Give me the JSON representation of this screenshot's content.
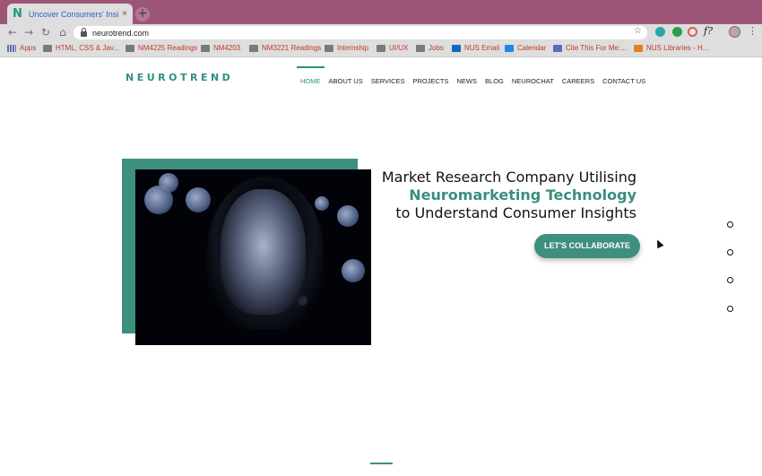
{
  "browser": {
    "tab_title": "Uncover Consumers' Insights",
    "tab_favicon": "N",
    "tab_close": "×",
    "new_tab": "+",
    "url": "neurotrend.com",
    "back": "←",
    "forward": "→",
    "reload": "↻",
    "home": "⌂",
    "star": "☆",
    "ext_f": "f?",
    "menu": "⋮"
  },
  "bookmarks": [
    {
      "label": "Apps",
      "icon": "apps-icon"
    },
    {
      "label": "HTML, CSS & Jav...",
      "icon": "folder-icon"
    },
    {
      "label": "NM4225 Readings",
      "icon": "folder-icon"
    },
    {
      "label": "NM4203",
      "icon": "folder-icon"
    },
    {
      "label": "NM3221 Readings",
      "icon": "folder-icon"
    },
    {
      "label": "Internship",
      "icon": "folder-icon"
    },
    {
      "label": "UI/UX",
      "icon": "folder-icon"
    },
    {
      "label": "Jobs",
      "icon": "folder-icon"
    },
    {
      "label": "NUS Email",
      "icon": "outlook-icon"
    },
    {
      "label": "Calendar",
      "icon": "calendar-icon"
    },
    {
      "label": "Cite This For Me:...",
      "icon": "doc-icon"
    },
    {
      "label": "NUS Libraries - H...",
      "icon": "library-icon"
    }
  ],
  "site": {
    "logo": "NEUROTREND",
    "nav": [
      "HOME",
      "ABOUT US",
      "SERVICES",
      "PROJECTS",
      "NEWS",
      "BLOG",
      "NEUROCHAT",
      "CAREERS",
      "CONTACT US"
    ],
    "headline": {
      "line1": "Market Research Company Utilising",
      "line2": "Neuromarketing Technology",
      "line3": "to Understand Consumer Insights"
    },
    "cta": "LET'S COLLABORATE"
  },
  "colors": {
    "accent": "#3e8f7e",
    "tabbar": "#9c5577"
  }
}
